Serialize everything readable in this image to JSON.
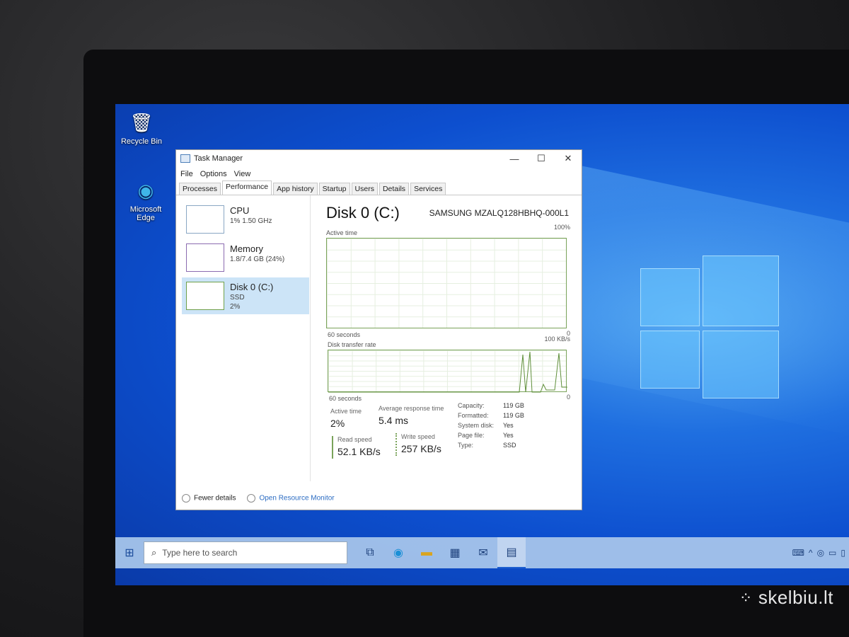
{
  "desktop": {
    "icons": [
      {
        "label": "Recycle Bin",
        "icon": "recycle-bin-icon"
      },
      {
        "label": "Microsoft Edge",
        "icon": "edge-icon"
      }
    ]
  },
  "taskmanager": {
    "title": "Task Manager",
    "window_buttons": [
      "—",
      "☐",
      "✕"
    ],
    "menu": [
      "File",
      "Options",
      "View"
    ],
    "tabs": [
      "Processes",
      "Performance",
      "App history",
      "Startup",
      "Users",
      "Details",
      "Services"
    ],
    "active_tab": "Performance",
    "sidebar": [
      {
        "name": "CPU",
        "sub1": "1% 1.50 GHz",
        "sub2": ""
      },
      {
        "name": "Memory",
        "sub1": "1.8/7.4 GB (24%)",
        "sub2": ""
      },
      {
        "name": "Disk 0 (C:)",
        "sub1": "SSD",
        "sub2": "2%"
      }
    ],
    "selected_item": "Disk 0 (C:)",
    "detail": {
      "title": "Disk 0 (C:)",
      "model": "SAMSUNG MZALQ128HBHQ-000L1",
      "graph1": {
        "label": "Active time",
        "max": "100%",
        "time": "60 seconds",
        "min": "0"
      },
      "graph2": {
        "label": "Disk transfer rate",
        "max": "100 KB/s",
        "time": "60 seconds",
        "min": "0"
      },
      "stats": {
        "active_time_label": "Active time",
        "active_time": "2%",
        "avg_resp_label": "Average response time",
        "avg_resp": "5.4 ms",
        "read_label": "Read speed",
        "read": "52.1 KB/s",
        "write_label": "Write speed",
        "write": "257 KB/s"
      },
      "properties": [
        {
          "k": "Capacity:",
          "v": "119 GB"
        },
        {
          "k": "Formatted:",
          "v": "119 GB"
        },
        {
          "k": "System disk:",
          "v": "Yes"
        },
        {
          "k": "Page file:",
          "v": "Yes"
        },
        {
          "k": "Type:",
          "v": "SSD"
        }
      ]
    },
    "footer": {
      "fewer": "Fewer details",
      "resmon": "Open Resource Monitor"
    }
  },
  "taskbar": {
    "search_placeholder": "Type here to search",
    "pinned": [
      "task-view-icon",
      "edge-icon",
      "file-explorer-icon",
      "store-icon",
      "mail-icon",
      "task-manager-icon"
    ]
  },
  "watermark": "skelbiu.lt"
}
